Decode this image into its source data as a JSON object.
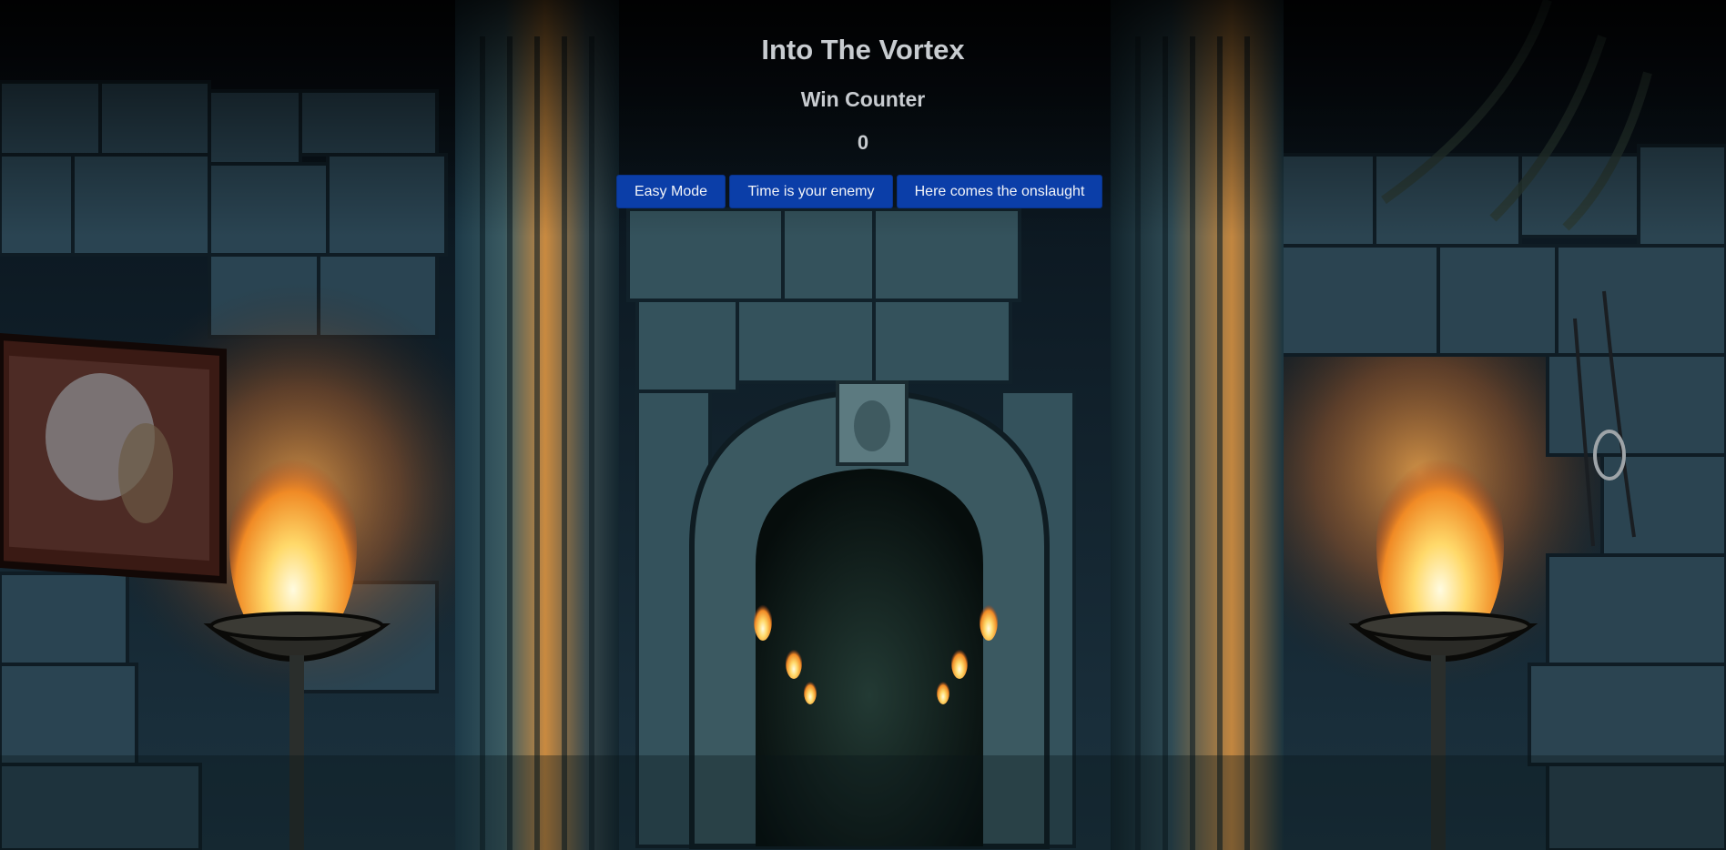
{
  "game": {
    "title": "Into The Vortex",
    "counter_label": "Win Counter",
    "counter_value": "0"
  },
  "modes": [
    {
      "label": "Easy Mode"
    },
    {
      "label": "Time is your enemy"
    },
    {
      "label": "Here comes the onslaught"
    }
  ],
  "colors": {
    "button_bg": "#0b3ea8",
    "title_text": "#c8ccd0",
    "button_text": "#f2f4f8"
  }
}
